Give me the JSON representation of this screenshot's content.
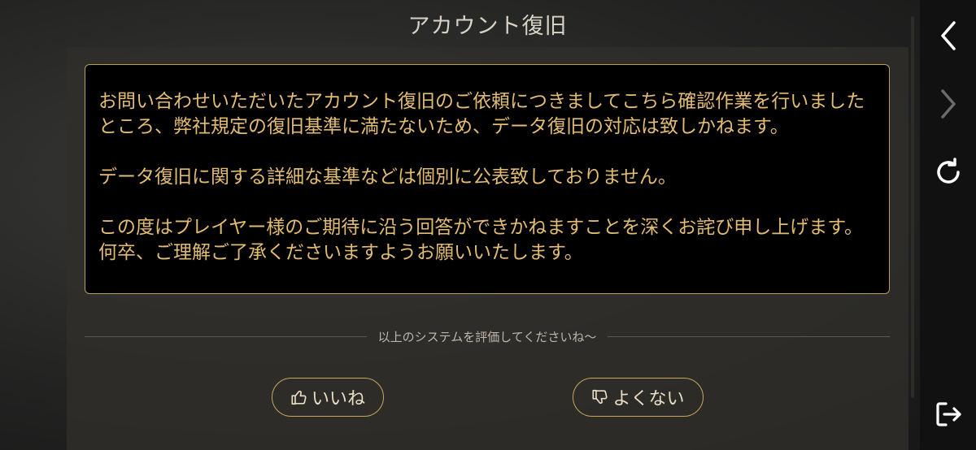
{
  "title": "アカウント復旧",
  "message": {
    "paragraphs": [
      "お問い合わせいただいたアカウント復旧のご依頼につきましてこちら確認作業を行いましたところ、弊社規定の復旧基準に満たないため、データ復旧の対応は致しかねます。",
      "データ復旧に関する詳細な基準などは個別に公表致しておりません。",
      "この度はプレイヤー様のご期待に沿う回答ができかねますことを深くお詫び申し上げます。何卒、ご理解ご了承くださいますようお願いいたします。"
    ]
  },
  "rating": {
    "prompt": "以上のシステムを評価してくださいね～",
    "like_label": "いいね",
    "dislike_label": "よくない"
  },
  "sidebar": {
    "icons": [
      "back-icon",
      "forward-icon",
      "refresh-icon",
      "exit-icon"
    ]
  },
  "colors": {
    "accent_gold": "#e2bc72",
    "border_gold": "#b89d5a",
    "message_bg": "#000000"
  }
}
